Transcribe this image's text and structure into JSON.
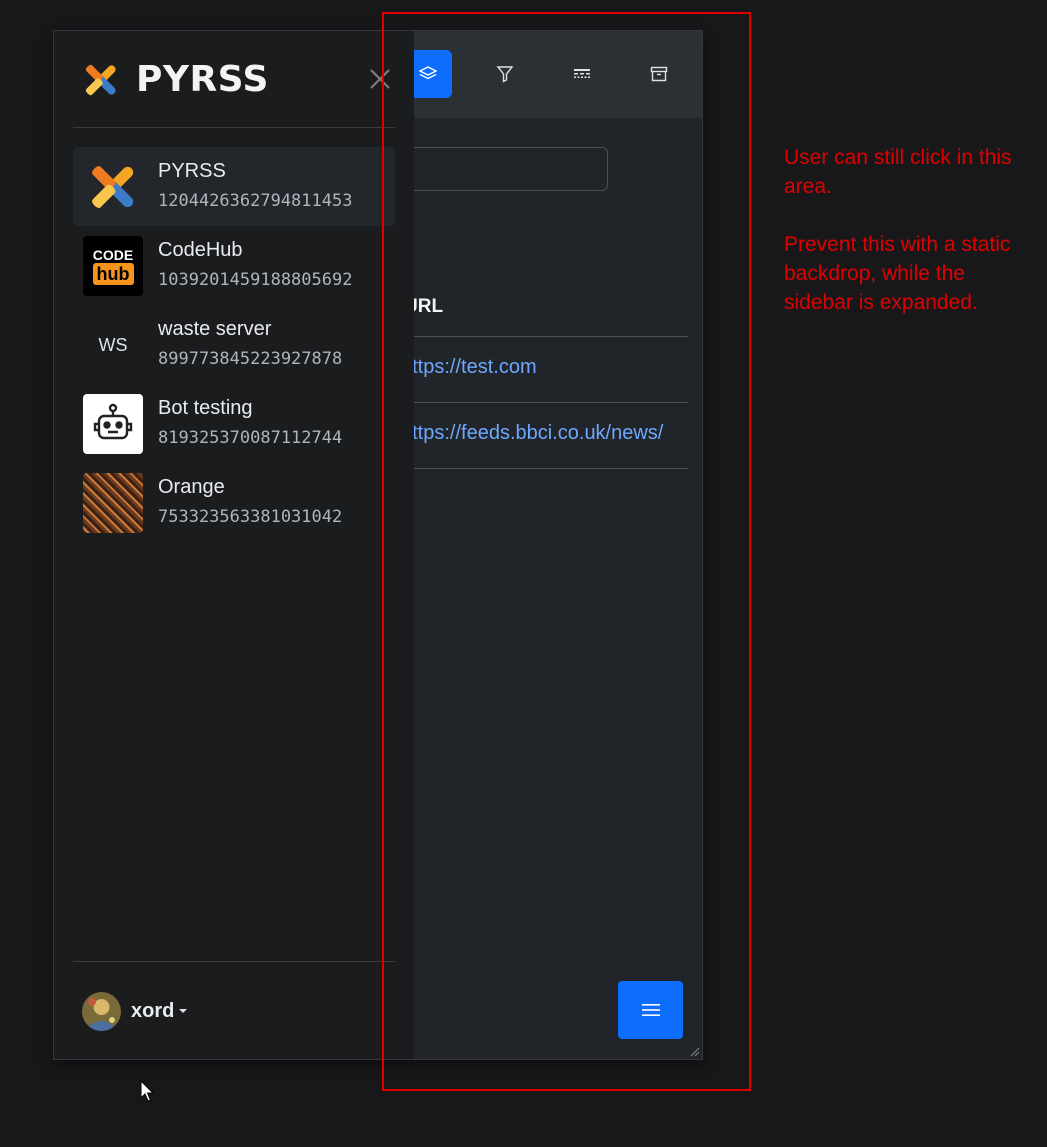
{
  "sidebar": {
    "brand_name": "PYRSS",
    "close_icon": "close-icon",
    "servers": [
      {
        "name": "PYRSS",
        "id": "1204426362794811453",
        "icon": "pyrss-logo",
        "active": true
      },
      {
        "name": "CodeHub",
        "id": "1039201459188805692",
        "icon": "codehub-logo",
        "icon_text_top": "CODE",
        "icon_text_bottom": "hub"
      },
      {
        "name": "waste server",
        "id": "899773845223927878",
        "icon": "text-initials",
        "initials": "WS"
      },
      {
        "name": "Bot testing",
        "id": "819325370087112744",
        "icon": "robot-icon"
      },
      {
        "name": "Orange",
        "id": "753323563381031042",
        "icon": "orange-pattern"
      }
    ],
    "user": {
      "name": "xord",
      "avatar": "user-avatar"
    }
  },
  "toolbar": {
    "buttons": [
      {
        "icon": "layers-icon",
        "active": true
      },
      {
        "icon": "filter-icon",
        "active": false
      },
      {
        "icon": "style-icon",
        "active": false
      },
      {
        "icon": "archive-icon",
        "active": false
      }
    ]
  },
  "table": {
    "column_header": "URL",
    "rows": [
      "https://test.com",
      "https://feeds.bbci.co.uk/news/"
    ]
  },
  "menu_button_icon": "hamburger-icon",
  "annotation": {
    "note_line1": "User can still click in this area.",
    "note_line2": "Prevent this with a static backdrop, while the sidebar is expanded.",
    "color": "#e00000"
  },
  "colors": {
    "accent": "#0d6efd",
    "link": "#6ea8fe"
  }
}
